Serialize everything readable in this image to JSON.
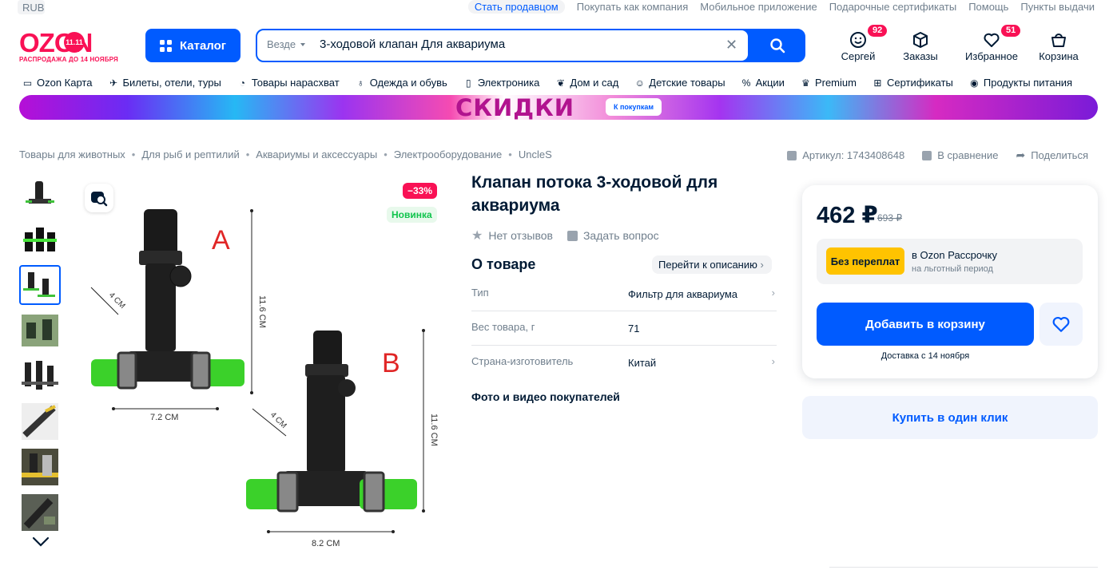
{
  "topbar": {
    "currency": "RUB",
    "links": [
      "Стать продавцом",
      "Покупать как компания",
      "Мобильное приложение",
      "Подарочные сертификаты",
      "Помощь",
      "Пункты выдачи"
    ]
  },
  "header": {
    "logo_text": "OZON",
    "logo_badge": "11.11",
    "logo_sub": "РАСПРОДАЖА ДО 14 НОЯБРЯ",
    "catalog_label": "Каталог",
    "search": {
      "scope": "Везде",
      "value": "3-ходовой клапан Для аквариума"
    },
    "actions": [
      {
        "label": "Сергей",
        "count": "92",
        "icon": "face-icon"
      },
      {
        "label": "Заказы",
        "count": "",
        "icon": "box-icon"
      },
      {
        "label": "Избранное",
        "count": "51",
        "icon": "heart-icon"
      },
      {
        "label": "Корзина",
        "count": "",
        "icon": "cart-icon"
      }
    ]
  },
  "catnav": [
    {
      "label": "Ozon Карта",
      "icon": "card-icon"
    },
    {
      "label": "Билеты, отели, туры",
      "icon": "plane-icon"
    },
    {
      "label": "Товары нарасхват",
      "icon": "clock-icon"
    },
    {
      "label": "Одежда и обувь",
      "icon": "shirt-icon"
    },
    {
      "label": "Электроника",
      "icon": "phone-icon"
    },
    {
      "label": "Дом и сад",
      "icon": "plant-icon"
    },
    {
      "label": "Детские товары",
      "icon": "baby-icon"
    },
    {
      "label": "Акции",
      "icon": "percent-icon"
    },
    {
      "label": "Premium",
      "icon": "crown-icon"
    },
    {
      "label": "Сертификаты",
      "icon": "gift-icon"
    },
    {
      "label": "Продукты питания",
      "icon": "food-icon"
    }
  ],
  "banner": {
    "title": "СКИДКИ",
    "button": "К покупкам"
  },
  "breadcrumbs": [
    "Товары для животных",
    "Для рыб и рептилий",
    "Аквариумы и аксессуары",
    "Электрооборудование",
    "UncleS"
  ],
  "meta": {
    "article": "Артикул: 1743408648",
    "compare": "В сравнение",
    "share": "Поделиться"
  },
  "gallery": {
    "discount": "−33%",
    "new_label": "Новинка",
    "labels": {
      "a": "A",
      "b": "B"
    },
    "dims": {
      "a_w": "7.2 CM",
      "a_h": "11.6 CM",
      "a_d": "4 CM",
      "b_w": "8.2 CM",
      "b_h": "11.6 CM",
      "b_d": "4 CM"
    }
  },
  "product": {
    "title": "Клапан потока 3-ходовой для аквариума",
    "reviews": "Нет отзывов",
    "ask": "Задать вопрос",
    "about": "О товаре",
    "goto_desc": "Перейти к описанию",
    "specs": [
      {
        "key": "Тип",
        "value": "Фильтр для аквариума"
      },
      {
        "key": "Вес товара, г",
        "value": "71"
      },
      {
        "key": "Страна-изготовитель",
        "value": "Китай"
      }
    ],
    "media_title": "Фото и видео покупателей"
  },
  "buybox": {
    "price": "462 ₽",
    "old_price": "693 ₽",
    "no_overpay": "Без переплат",
    "installment_title": "в Ozon Рассрочку",
    "installment_sub": "на льготный период",
    "add_to_cart": "Добавить в корзину",
    "delivery": "Доставка с 14 ноября",
    "one_click": "Купить в один клик"
  },
  "colors": {
    "brand_blue": "#005bff",
    "ozon_pink": "#f91155",
    "yellow": "#ffc300"
  }
}
